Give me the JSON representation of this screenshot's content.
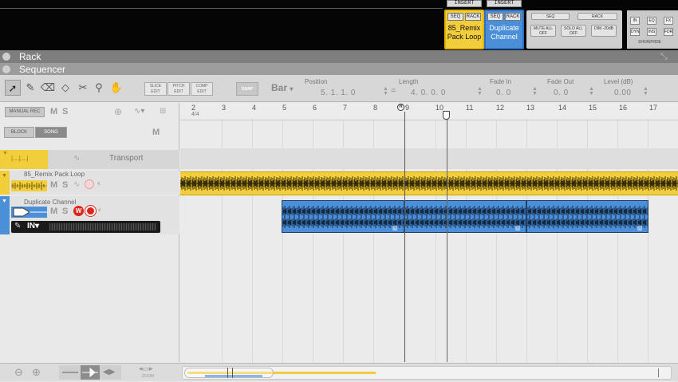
{
  "mixer": {
    "insert_labels": [
      "INSERT",
      "INSERT"
    ],
    "channels": [
      {
        "seq": "SEQ",
        "rack": "RACK",
        "name_line1": "85_Remix",
        "name_line2": "Pack Loop",
        "color": "#f2cd3c"
      },
      {
        "seq": "SEQ",
        "rack": "RACK",
        "name_line1": "Duplicate",
        "name_line2": "Channel",
        "color": "#4a8fd8"
      }
    ],
    "master": {
      "seq": "SEQ",
      "rack": "RACK",
      "mute_all": "MUTE ALL OFF",
      "solo_all": "SOLO ALL OFF",
      "dim": "DIM -20dB"
    },
    "side_buttons": [
      "IN",
      "EQ",
      "FX",
      "DYN",
      "INS",
      "FDR"
    ],
    "show_hide": "SHOW/HIDE"
  },
  "sections": {
    "rack": "Rack",
    "sequencer": "Sequencer"
  },
  "toolbar": {
    "edit_buttons": [
      "SLICE EDIT",
      "PITCH EDIT",
      "COMP EDIT"
    ],
    "snap": "SNAP",
    "snap_value": "Bar",
    "position_label": "Position",
    "position_value": "5.  1.  1.    0",
    "length_label": "Length",
    "length_value": "4.  0.  0.    0",
    "fade_in_label": "Fade In",
    "fade_in_value": "0.   0",
    "fade_out_label": "Fade Out",
    "fade_out_value": "0.   0",
    "level_label": "Level (dB)",
    "level_value": "0.00"
  },
  "track_panel": {
    "manual_rec": "MANUAL REC",
    "m": "M",
    "s": "S",
    "block": "BLOCK",
    "song": "SONG",
    "transport": "Transport",
    "track1_name": "85_Remix Pack Loop",
    "track2_name": "Duplicate Channel",
    "input_label": "IN"
  },
  "ruler": {
    "bars": [
      "2",
      "3",
      "4",
      "5",
      "6",
      "7",
      "8",
      "9",
      "10",
      "11",
      "12",
      "13",
      "14",
      "15",
      "16",
      "17"
    ],
    "time_signature": "4/4",
    "loop_marker": "R"
  },
  "bottom": {
    "zoom_label": "ZOOM"
  },
  "colors": {
    "yellow": "#f2cd3c",
    "blue": "#4a8fd8",
    "waveform": "#1a1a1a",
    "rec_red": "#e0231a"
  }
}
